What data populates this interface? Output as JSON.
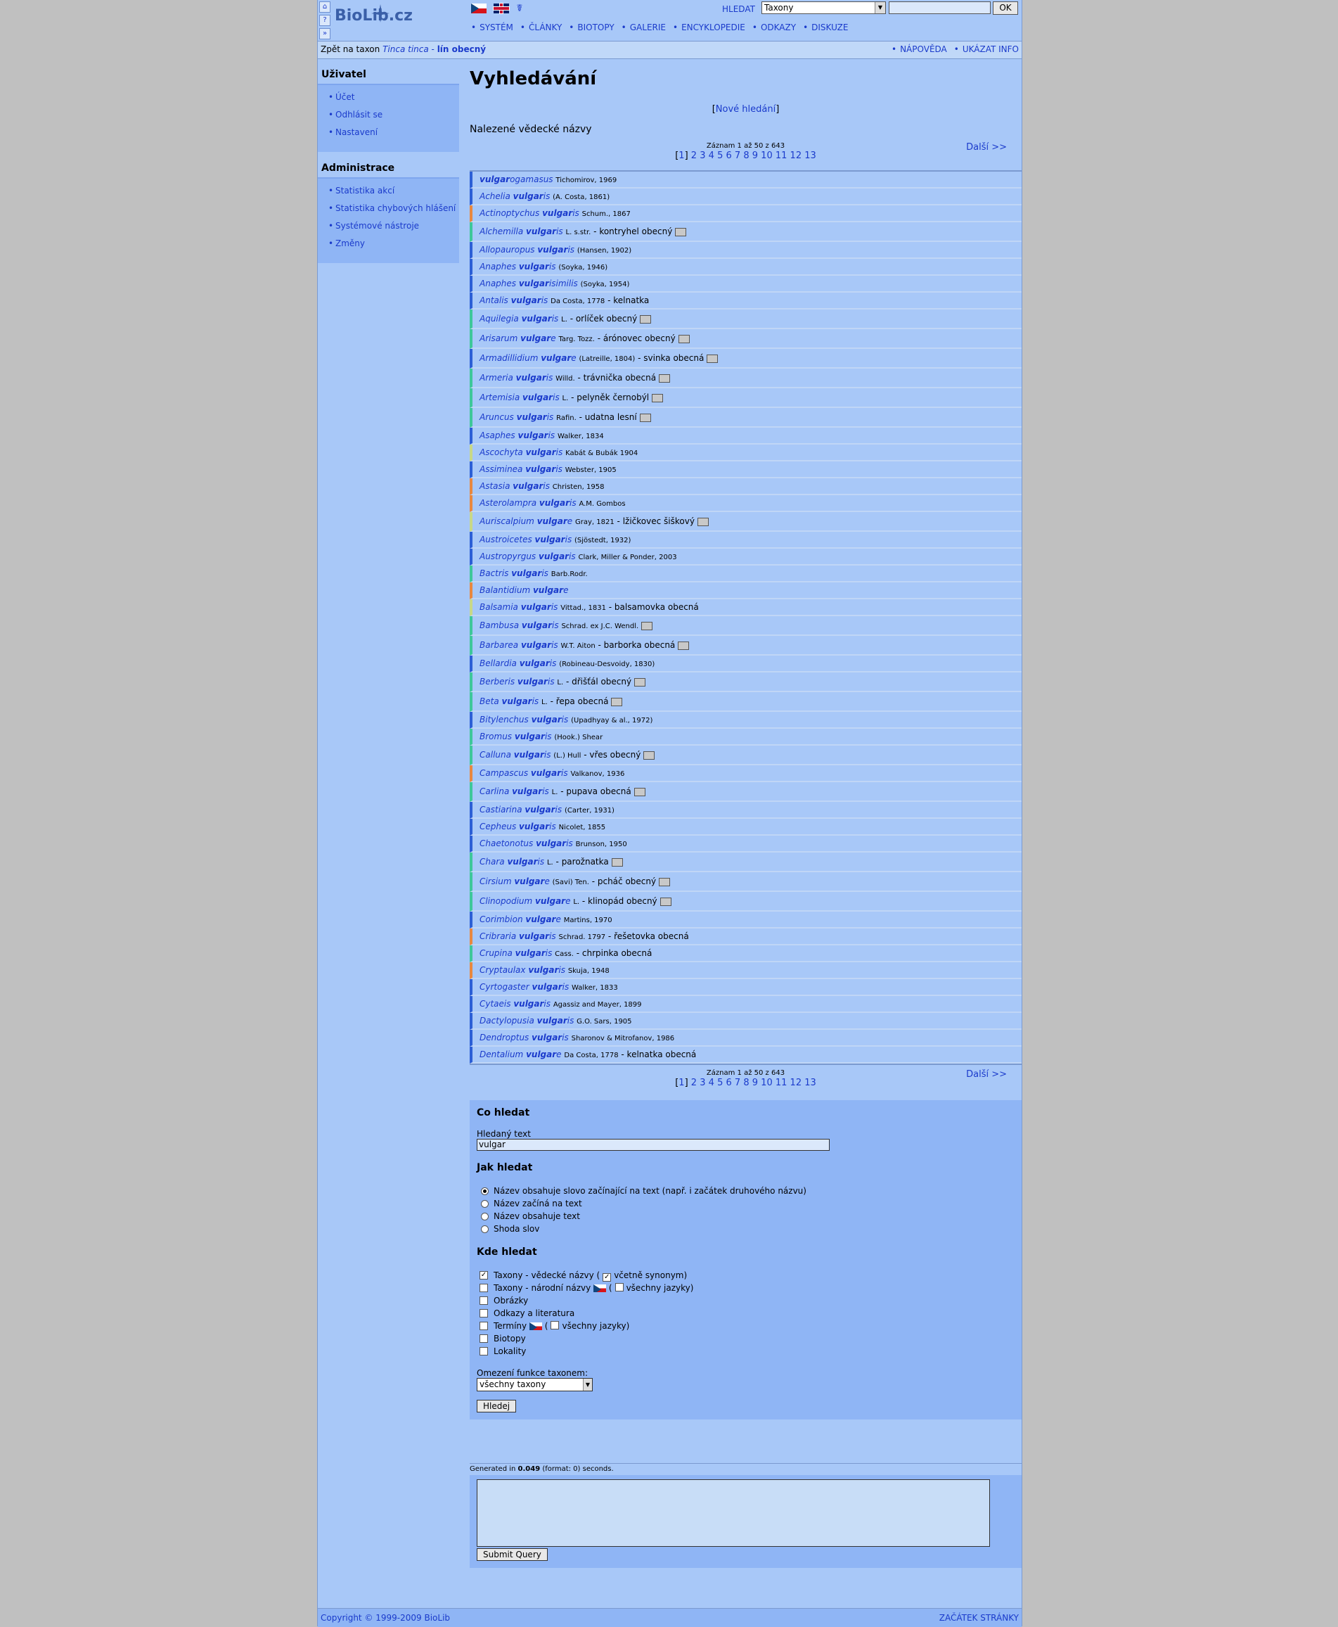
{
  "header": {
    "logo_text": "BioLib.cz",
    "search_label": "HLEDAT",
    "search_select": "Taxony",
    "search_ok": "OK",
    "nav": [
      "SYSTÉM",
      "ČLÁNKY",
      "BIOTOPY",
      "GALERIE",
      "ENCYKLOPEDIE",
      "ODKAZY",
      "DISKUZE"
    ]
  },
  "bar": {
    "back_prefix": "Zpět na taxon ",
    "back_taxon": "Tinca tinca",
    "back_sep": " - ",
    "back_name": "lín obecný",
    "help": "NÁPOVĚDA",
    "info": "UKÁZAT INFO"
  },
  "sidebar": {
    "user_title": "Uživatel",
    "user_items": [
      "Účet",
      "Odhlásit se",
      "Nastavení"
    ],
    "admin_title": "Administrace",
    "admin_items": [
      "Statistika akcí",
      "Statistika chybových hlášení",
      "Systémové nástroje",
      "Změny"
    ]
  },
  "main": {
    "title": "Vyhledávání",
    "new_search": "Nové hledání",
    "found_title": "Nalezené vědecké názvy",
    "pager_info": "Záznam 1 až 50 z 643",
    "pager_current": "1",
    "pager_pages": [
      "2",
      "3",
      "4",
      "5",
      "6",
      "7",
      "8",
      "9",
      "10",
      "11",
      "12",
      "13"
    ],
    "pager_next": "Další >>"
  },
  "results": [
    {
      "pre": "",
      "hit": "vulgar",
      "post": "ogamasus",
      "auth": "Tichomirov, 1969",
      "cz": "",
      "img": false,
      "c": "blue"
    },
    {
      "pre": "Achelia ",
      "hit": "vulgar",
      "post": "is",
      "auth": "(A. Costa, 1861)",
      "cz": "",
      "img": false,
      "c": "blue"
    },
    {
      "pre": "Actinoptychus ",
      "hit": "vulgar",
      "post": "is",
      "auth": "Schum., 1867",
      "cz": "",
      "img": false,
      "c": "orange"
    },
    {
      "pre": "Alchemilla ",
      "hit": "vulgar",
      "post": "is",
      "auth": "L. s.str.",
      "cz": "kontryhel obecný",
      "img": true,
      "c": "green"
    },
    {
      "pre": "Allopauropus ",
      "hit": "vulgar",
      "post": "is",
      "auth": "(Hansen, 1902)",
      "cz": "",
      "img": false,
      "c": "blue"
    },
    {
      "pre": "Anaphes ",
      "hit": "vulgar",
      "post": "is",
      "auth": "(Soyka, 1946)",
      "cz": "",
      "img": false,
      "c": "blue"
    },
    {
      "pre": "Anaphes ",
      "hit": "vulgar",
      "post": "isimilis",
      "auth": "(Soyka, 1954)",
      "cz": "",
      "img": false,
      "c": "blue"
    },
    {
      "pre": "Antalis ",
      "hit": "vulgar",
      "post": "is",
      "auth": "Da Costa, 1778",
      "cz": "kelnatka",
      "img": false,
      "c": "blue"
    },
    {
      "pre": "Aquilegia ",
      "hit": "vulgar",
      "post": "is",
      "auth": "L.",
      "cz": "orlíček obecný",
      "img": true,
      "c": "green"
    },
    {
      "pre": "Arisarum ",
      "hit": "vulgar",
      "post": "e",
      "auth": "Targ. Tozz.",
      "cz": "árónovec obecný",
      "img": true,
      "c": "green"
    },
    {
      "pre": "Armadillidium ",
      "hit": "vulgar",
      "post": "e",
      "auth": "(Latreille, 1804)",
      "cz": "svinka obecná",
      "img": true,
      "c": "blue"
    },
    {
      "pre": "Armeria ",
      "hit": "vulgar",
      "post": "is",
      "auth": "Willd.",
      "cz": "trávnička obecná",
      "img": true,
      "c": "green"
    },
    {
      "pre": "Artemisia ",
      "hit": "vulgar",
      "post": "is",
      "auth": "L.",
      "cz": "pelyněk černobýl",
      "img": true,
      "c": "green"
    },
    {
      "pre": "Aruncus ",
      "hit": "vulgar",
      "post": "is",
      "auth": "Rafin.",
      "cz": "udatna lesní",
      "img": true,
      "c": "green"
    },
    {
      "pre": "Asaphes ",
      "hit": "vulgar",
      "post": "is",
      "auth": "Walker, 1834",
      "cz": "",
      "img": false,
      "c": "blue"
    },
    {
      "pre": "Ascochyta ",
      "hit": "vulgar",
      "post": "is",
      "auth": "Kabát & Bubák 1904",
      "cz": "",
      "img": false,
      "c": "yellow"
    },
    {
      "pre": "Assiminea ",
      "hit": "vulgar",
      "post": "is",
      "auth": "Webster, 1905",
      "cz": "",
      "img": false,
      "c": "blue"
    },
    {
      "pre": "Astasia ",
      "hit": "vulgar",
      "post": "is",
      "auth": "Christen, 1958",
      "cz": "",
      "img": false,
      "c": "orange"
    },
    {
      "pre": "Asterolampra ",
      "hit": "vulgar",
      "post": "is",
      "auth": "A.M. Gombos",
      "cz": "",
      "img": false,
      "c": "orange"
    },
    {
      "pre": "Auriscalpium ",
      "hit": "vulgar",
      "post": "e",
      "auth": "Gray, 1821",
      "cz": "lžičkovec šiškový",
      "img": true,
      "c": "yellow"
    },
    {
      "pre": "Austroicetes ",
      "hit": "vulgar",
      "post": "is",
      "auth": "(Sjöstedt, 1932)",
      "cz": "",
      "img": false,
      "c": "blue"
    },
    {
      "pre": "Austropyrgus ",
      "hit": "vulgar",
      "post": "is",
      "auth": "Clark, Miller & Ponder, 2003",
      "cz": "",
      "img": false,
      "c": "blue"
    },
    {
      "pre": "Bactris ",
      "hit": "vulgar",
      "post": "is",
      "auth": "Barb.Rodr.",
      "cz": "",
      "img": false,
      "c": "green"
    },
    {
      "pre": "Balantidium ",
      "hit": "vulgar",
      "post": "e",
      "auth": "",
      "cz": "",
      "img": false,
      "c": "orange"
    },
    {
      "pre": "Balsamia ",
      "hit": "vulgar",
      "post": "is",
      "auth": "Vittad., 1831",
      "cz": "balsamovka obecná",
      "img": false,
      "c": "yellow"
    },
    {
      "pre": "Bambusa ",
      "hit": "vulgar",
      "post": "is",
      "auth": "Schrad. ex J.C. Wendl.",
      "cz": "",
      "img": true,
      "c": "green"
    },
    {
      "pre": "Barbarea ",
      "hit": "vulgar",
      "post": "is",
      "auth": "W.T. Aiton",
      "cz": "barborka obecná",
      "img": true,
      "c": "green"
    },
    {
      "pre": "Bellardia ",
      "hit": "vulgar",
      "post": "is",
      "auth": "(Robineau-Desvoidy, 1830)",
      "cz": "",
      "img": false,
      "c": "blue"
    },
    {
      "pre": "Berberis ",
      "hit": "vulgar",
      "post": "is",
      "auth": "L.",
      "cz": "dřišťál obecný",
      "img": true,
      "c": "green"
    },
    {
      "pre": "Beta ",
      "hit": "vulgar",
      "post": "is",
      "auth": "L.",
      "cz": "řepa obecná",
      "img": true,
      "c": "green"
    },
    {
      "pre": "Bitylenchus ",
      "hit": "vulgar",
      "post": "is",
      "auth": "(Upadhyay & al., 1972)",
      "cz": "",
      "img": false,
      "c": "blue"
    },
    {
      "pre": "Bromus ",
      "hit": "vulgar",
      "post": "is",
      "auth": "(Hook.) Shear",
      "cz": "",
      "img": false,
      "c": "green"
    },
    {
      "pre": "Calluna ",
      "hit": "vulgar",
      "post": "is",
      "auth": "(L.) Hull",
      "cz": "vřes obecný",
      "img": true,
      "c": "green"
    },
    {
      "pre": "Campascus ",
      "hit": "vulgar",
      "post": "is",
      "auth": "Valkanov, 1936",
      "cz": "",
      "img": false,
      "c": "orange"
    },
    {
      "pre": "Carlina ",
      "hit": "vulgar",
      "post": "is",
      "auth": "L.",
      "cz": "pupava obecná",
      "img": true,
      "c": "green"
    },
    {
      "pre": "Castiarina ",
      "hit": "vulgar",
      "post": "is",
      "auth": "(Carter, 1931)",
      "cz": "",
      "img": false,
      "c": "blue"
    },
    {
      "pre": "Cepheus ",
      "hit": "vulgar",
      "post": "is",
      "auth": "Nicolet, 1855",
      "cz": "",
      "img": false,
      "c": "blue"
    },
    {
      "pre": "Chaetonotus ",
      "hit": "vulgar",
      "post": "is",
      "auth": "Brunson, 1950",
      "cz": "",
      "img": false,
      "c": "blue"
    },
    {
      "pre": "Chara ",
      "hit": "vulgar",
      "post": "is",
      "auth": "L.",
      "cz": "parožnatka",
      "img": true,
      "c": "green"
    },
    {
      "pre": "Cirsium ",
      "hit": "vulgar",
      "post": "e",
      "auth": "(Savi) Ten.",
      "cz": "pcháč obecný",
      "img": true,
      "c": "green"
    },
    {
      "pre": "Clinopodium ",
      "hit": "vulgar",
      "post": "e",
      "auth": "L.",
      "cz": "klinopád obecný",
      "img": true,
      "c": "green"
    },
    {
      "pre": "Corimbion ",
      "hit": "vulgar",
      "post": "e",
      "auth": "Martins, 1970",
      "cz": "",
      "img": false,
      "c": "blue"
    },
    {
      "pre": "Cribraria ",
      "hit": "vulgar",
      "post": "is",
      "auth": "Schrad. 1797",
      "cz": "řešetovka obecná",
      "img": false,
      "c": "orange"
    },
    {
      "pre": "Crupina ",
      "hit": "vulgar",
      "post": "is",
      "auth": "Cass.",
      "cz": "chrpinka obecná",
      "img": false,
      "c": "green"
    },
    {
      "pre": "Cryptaulax ",
      "hit": "vulgar",
      "post": "is",
      "auth": "Skuja, 1948",
      "cz": "",
      "img": false,
      "c": "orange"
    },
    {
      "pre": "Cyrtogaster ",
      "hit": "vulgar",
      "post": "is",
      "auth": "Walker, 1833",
      "cz": "",
      "img": false,
      "c": "blue"
    },
    {
      "pre": "Cytaeis ",
      "hit": "vulgar",
      "post": "is",
      "auth": "Agassiz and Mayer, 1899",
      "cz": "",
      "img": false,
      "c": "blue"
    },
    {
      "pre": "Dactylopusia ",
      "hit": "vulgar",
      "post": "is",
      "auth": "G.O. Sars, 1905",
      "cz": "",
      "img": false,
      "c": "blue"
    },
    {
      "pre": "Dendroptus ",
      "hit": "vulgar",
      "post": "is",
      "auth": "Sharonov & Mitrofanov, 1986",
      "cz": "",
      "img": false,
      "c": "blue"
    },
    {
      "pre": "Dentalium ",
      "hit": "vulgar",
      "post": "e",
      "auth": "Da Costa, 1778",
      "cz": "kelnatka obecná",
      "img": false,
      "c": "blue"
    }
  ],
  "form": {
    "what_title": "Co hledat",
    "text_label": "Hledaný text",
    "text_value": "vulgar",
    "how_title": "Jak hledat",
    "how_options": [
      "Název obsahuje slovo začínající na text (např. i začátek druhového názvu)",
      "Název začíná na text",
      "Název obsahuje text",
      "Shoda slov"
    ],
    "where_title": "Kde hledat",
    "where_sci": "Taxony - vědecké názvy (",
    "where_sci_syn": "včetně synonym)",
    "where_nat": "Taxony - národní názvy",
    "where_nat_all": "všechny jazyky)",
    "where_img": "Obrázky",
    "where_links": "Odkazy a literatura",
    "where_terms": "Termíny",
    "where_terms_all": "všechny jazyky)",
    "where_biotops": "Biotopy",
    "where_local": "Lokality",
    "limit_label": "Omezení funkce taxonem:",
    "limit_value": "všechny taxony",
    "submit": "Hledej"
  },
  "generated": {
    "prefix": "Generated in ",
    "time": "0.049",
    "suffix": " (format: 0) seconds."
  },
  "submit_query": "Submit Query",
  "footer": {
    "copyright": "Copyright © 1999-2009 BioLib",
    "top": "ZAČÁTEK STRÁNKY"
  }
}
